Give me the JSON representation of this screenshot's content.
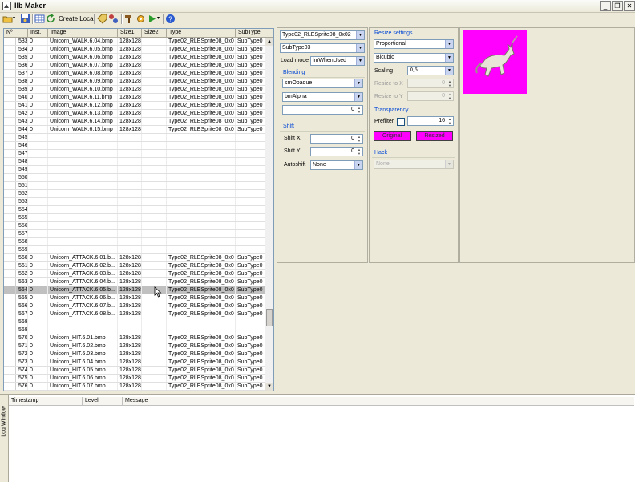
{
  "window": {
    "title": "llb Maker",
    "controls": [
      "_",
      "❐",
      "✕"
    ]
  },
  "toolbar": {
    "create_local_label": "Create Local"
  },
  "grid": {
    "headers": [
      "Nº",
      "Inst.",
      "Image",
      "Size1",
      "Size2",
      "Type",
      "SubType"
    ],
    "rows": [
      [
        "533",
        "0",
        "Unicorn_WALK.6.04.bmp",
        "128x128",
        "",
        "Type02_RLESprite08_0x0",
        "SubType0"
      ],
      [
        "534",
        "0",
        "Unicorn_WALK.6.05.bmp",
        "128x128",
        "",
        "Type02_RLESprite08_0x0",
        "SubType0"
      ],
      [
        "535",
        "0",
        "Unicorn_WALK.6.06.bmp",
        "128x128",
        "",
        "Type02_RLESprite08_0x0",
        "SubType0"
      ],
      [
        "536",
        "0",
        "Unicorn_WALK.6.07.bmp",
        "128x128",
        "",
        "Type02_RLESprite08_0x0",
        "SubType0"
      ],
      [
        "537",
        "0",
        "Unicorn_WALK.6.08.bmp",
        "128x128",
        "",
        "Type02_RLESprite08_0x0",
        "SubType0"
      ],
      [
        "538",
        "0",
        "Unicorn_WALK.6.09.bmp",
        "128x128",
        "",
        "Type02_RLESprite08_0x0",
        "SubType0"
      ],
      [
        "539",
        "0",
        "Unicorn_WALK.6.10.bmp",
        "128x128",
        "",
        "Type02_RLESprite08_0x0",
        "SubType0"
      ],
      [
        "540",
        "0",
        "Unicorn_WALK.6.11.bmp",
        "128x128",
        "",
        "Type02_RLESprite08_0x0",
        "SubType0"
      ],
      [
        "541",
        "0",
        "Unicorn_WALK.6.12.bmp",
        "128x128",
        "",
        "Type02_RLESprite08_0x0",
        "SubType0"
      ],
      [
        "542",
        "0",
        "Unicorn_WALK.6.13.bmp",
        "128x128",
        "",
        "Type02_RLESprite08_0x0",
        "SubType0"
      ],
      [
        "543",
        "0",
        "Unicorn_WALK.6.14.bmp",
        "128x128",
        "",
        "Type02_RLESprite08_0x0",
        "SubType0"
      ],
      [
        "544",
        "0",
        "Unicorn_WALK.6.15.bmp",
        "128x128",
        "",
        "Type02_RLESprite08_0x0",
        "SubType0"
      ],
      [
        "545",
        "",
        "",
        "",
        "",
        "",
        ""
      ],
      [
        "546",
        "",
        "",
        "",
        "",
        "",
        ""
      ],
      [
        "547",
        "",
        "",
        "",
        "",
        "",
        ""
      ],
      [
        "548",
        "",
        "",
        "",
        "",
        "",
        ""
      ],
      [
        "549",
        "",
        "",
        "",
        "",
        "",
        ""
      ],
      [
        "550",
        "",
        "",
        "",
        "",
        "",
        ""
      ],
      [
        "551",
        "",
        "",
        "",
        "",
        "",
        ""
      ],
      [
        "552",
        "",
        "",
        "",
        "",
        "",
        ""
      ],
      [
        "553",
        "",
        "",
        "",
        "",
        "",
        ""
      ],
      [
        "554",
        "",
        "",
        "",
        "",
        "",
        ""
      ],
      [
        "555",
        "",
        "",
        "",
        "",
        "",
        ""
      ],
      [
        "556",
        "",
        "",
        "",
        "",
        "",
        ""
      ],
      [
        "557",
        "",
        "",
        "",
        "",
        "",
        ""
      ],
      [
        "558",
        "",
        "",
        "",
        "",
        "",
        ""
      ],
      [
        "559",
        "",
        "",
        "",
        "",
        "",
        ""
      ],
      [
        "560",
        "0",
        "Unicorn_ATTACK.6.01.b...",
        "128x128",
        "",
        "Type02_RLESprite08_0x0",
        "SubType0"
      ],
      [
        "561",
        "0",
        "Unicorn_ATTACK.6.02.b...",
        "128x128",
        "",
        "Type02_RLESprite08_0x0",
        "SubType0"
      ],
      [
        "562",
        "0",
        "Unicorn_ATTACK.6.03.b...",
        "128x128",
        "",
        "Type02_RLESprite08_0x0",
        "SubType0"
      ],
      [
        "563",
        "0",
        "Unicorn_ATTACK.6.04.b...",
        "128x128",
        "",
        "Type02_RLESprite08_0x0",
        "SubType0"
      ],
      [
        "564",
        "0",
        "Unicorn_ATTACK.6.05.b...",
        "128x128",
        "",
        "Type02_RLESprite08_0x0",
        "SubType0"
      ],
      [
        "565",
        "0",
        "Unicorn_ATTACK.6.06.b...",
        "128x128",
        "",
        "Type02_RLESprite08_0x0",
        "SubType0"
      ],
      [
        "566",
        "0",
        "Unicorn_ATTACK.6.07.b...",
        "128x128",
        "",
        "Type02_RLESprite08_0x0",
        "SubType0"
      ],
      [
        "567",
        "0",
        "Unicorn_ATTACK.6.08.b...",
        "128x128",
        "",
        "Type02_RLESprite08_0x0",
        "SubType0"
      ],
      [
        "568",
        "",
        "",
        "",
        "",
        "",
        ""
      ],
      [
        "569",
        "",
        "",
        "",
        "",
        "",
        ""
      ],
      [
        "570",
        "0",
        "Unicorn_HIT.6.01.bmp",
        "128x128",
        "",
        "Type02_RLESprite08_0x0",
        "SubType0"
      ],
      [
        "571",
        "0",
        "Unicorn_HIT.6.02.bmp",
        "128x128",
        "",
        "Type02_RLESprite08_0x0",
        "SubType0"
      ],
      [
        "572",
        "0",
        "Unicorn_HIT.6.03.bmp",
        "128x128",
        "",
        "Type02_RLESprite08_0x0",
        "SubType0"
      ],
      [
        "573",
        "0",
        "Unicorn_HIT.6.04.bmp",
        "128x128",
        "",
        "Type02_RLESprite08_0x0",
        "SubType0"
      ],
      [
        "574",
        "0",
        "Unicorn_HIT.6.05.bmp",
        "128x128",
        "",
        "Type02_RLESprite08_0x0",
        "SubType0"
      ],
      [
        "575",
        "0",
        "Unicorn_HIT.6.06.bmp",
        "128x128",
        "",
        "Type02_RLESprite08_0x0",
        "SubType0"
      ],
      [
        "576",
        "0",
        "Unicorn_HIT.6.07.bmp",
        "128x128",
        "",
        "Type02_RLESprite08_0x0",
        "SubType0"
      ]
    ],
    "selected_row": "564"
  },
  "sprite_panel": {
    "type_value": "Type02_RLESprite08_0x02",
    "subtype_value": "SubType03",
    "load_mode_label": "Load mode",
    "load_mode_value": "lmWhenUsed",
    "blending_title": "Blending",
    "blend_mode_value": "smOpaque",
    "alpha_mode_value": "bmAlpha",
    "blend_value": "0",
    "shift_title": "Shift",
    "shift_x_label": "Shift X",
    "shift_x_value": "0",
    "shift_y_label": "Shift Y",
    "shift_y_value": "0",
    "autoshift_label": "Autoshift",
    "autoshift_value": "None"
  },
  "resize_panel": {
    "resize_title": "Resize settings",
    "proportion_value": "Proportional",
    "filter_value": "Bicubic",
    "scaling_label": "Scaling",
    "scaling_value": "0,5",
    "resize_x_label": "Resize to X",
    "resize_x_value": "0",
    "resize_y_label": "Resize to Y",
    "resize_y_value": "0",
    "transparency_title": "Transparency",
    "prefilter_label": "Prefilter",
    "prefilter_value": "16",
    "original_label": "Original",
    "resized_label": "Resized",
    "hack_title": "Hack",
    "hack_value": "None"
  },
  "preview": {
    "background_color": "#ff00ff"
  },
  "log": {
    "tab_label": "Log Window",
    "columns": [
      "Timestamp",
      "Level",
      "Message"
    ]
  }
}
